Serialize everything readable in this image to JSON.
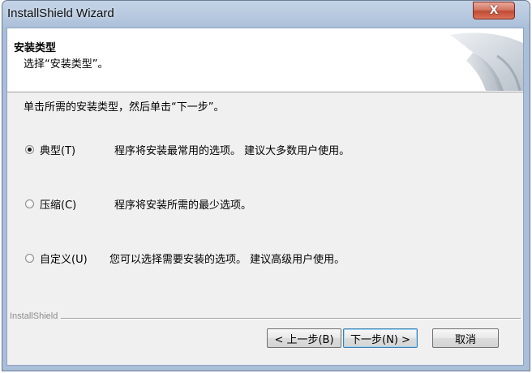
{
  "window": {
    "title": "InstallShield Wizard",
    "close_glyph": "X"
  },
  "header": {
    "title": "安装类型",
    "subtitle": "选择“安装类型”。"
  },
  "instruction": "单击所需的安装类型，然后单击“下一步”。",
  "options": [
    {
      "label": "典型(T)",
      "description": "程序将安装最常用的选项。  建议大多数用户使用。",
      "checked": true
    },
    {
      "label": "压缩(C)",
      "description": "程序将安装所需的最少选项。",
      "checked": false
    },
    {
      "label": "自定义(U)",
      "description": "您可以选择需要安装的选项。 建议高级用户使用。",
      "checked": false
    }
  ],
  "brand": "InstallShield",
  "buttons": {
    "back": "< 上一步(B)",
    "next": "下一步(N) >",
    "cancel": "取消"
  },
  "colors": {
    "title_bar": "#b6c8df",
    "close_button": "#c24a33",
    "dialog_background": "#f0f0f0",
    "header_background": "#ffffff"
  }
}
